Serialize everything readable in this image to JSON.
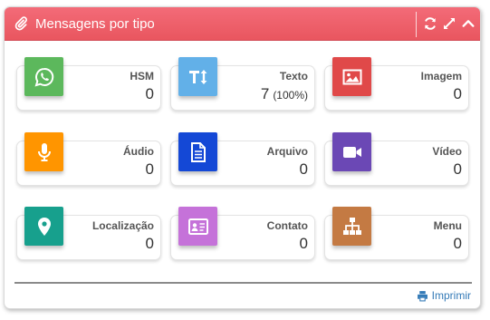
{
  "panel": {
    "title": "Mensagens por tipo",
    "title_icon": "paperclip-icon",
    "tools": [
      "refresh-icon",
      "expand-icon",
      "collapse-icon"
    ],
    "header_color": "#ea5b65"
  },
  "cards": [
    {
      "label": "HSM",
      "value": "0",
      "icon": "whatsapp-icon",
      "color": "#5cb85c"
    },
    {
      "label": "Texto",
      "value": "7",
      "percent": "(100%)",
      "icon": "text-height-icon",
      "color": "#62b0e8"
    },
    {
      "label": "Imagem",
      "value": "0",
      "icon": "image-icon",
      "color": "#e04949"
    },
    {
      "label": "Áudio",
      "value": "0",
      "icon": "microphone-icon",
      "color": "#ff9500"
    },
    {
      "label": "Arquivo",
      "value": "0",
      "icon": "file-text-icon",
      "color": "#1448d6"
    },
    {
      "label": "Vídeo",
      "value": "0",
      "icon": "video-camera-icon",
      "color": "#6b48b5"
    },
    {
      "label": "Localização",
      "value": "0",
      "icon": "map-marker-icon",
      "color": "#17a08d"
    },
    {
      "label": "Contato",
      "value": "0",
      "icon": "address-card-icon",
      "color": "#c572d9"
    },
    {
      "label": "Menu",
      "value": "0",
      "icon": "sitemap-icon",
      "color": "#c47a43"
    }
  ],
  "footer": {
    "print_label": "Imprimir",
    "print_icon": "print-icon",
    "link_color": "#337ab7"
  }
}
